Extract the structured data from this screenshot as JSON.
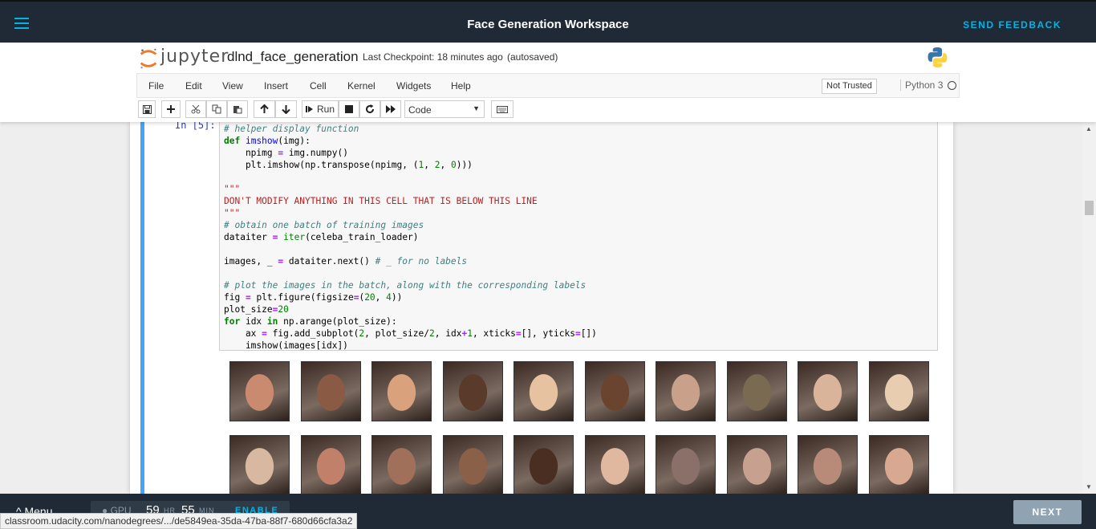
{
  "topbar": {
    "title": "Face Generation Workspace",
    "feedback_label": "SEND FEEDBACK",
    "accent": "#02b3e4"
  },
  "jupyter": {
    "logo_text": "jupyter",
    "notebook_name": "dlnd_face_generation",
    "checkpoint": "Last Checkpoint: 18 minutes ago",
    "autosaved": "(autosaved)",
    "menu": [
      "File",
      "Edit",
      "View",
      "Insert",
      "Cell",
      "Kernel",
      "Widgets",
      "Help"
    ],
    "trusted": "Not Trusted",
    "kernel": "Python 3",
    "run_label": "Run",
    "cell_type": "Code"
  },
  "cell": {
    "prompt": "In [5]:",
    "code_lines": [
      "# helper display function",
      "def imshow(img):",
      "    npimg = img.numpy()",
      "    plt.imshow(np.transpose(npimg, (1, 2, 0)))",
      "",
      "\"\"\"",
      "DON'T MODIFY ANYTHING IN THIS CELL THAT IS BELOW THIS LINE",
      "\"\"\"",
      "# obtain one batch of training images",
      "dataiter = iter(celeba_train_loader)",
      "",
      "images, _ = dataiter.next() # _ for no labels",
      "",
      "# plot the images in the batch, along with the corresponding labels",
      "fig = plt.figure(figsize=(20, 4))",
      "plot_size=20",
      "for idx in np.arange(plot_size):",
      "    ax = fig.add_subplot(2, plot_size/2, idx+1, xticks=[], yticks=[])",
      "    imshow(images[idx])"
    ]
  },
  "faces": {
    "count": 20,
    "skin_tones": [
      "#c98a70",
      "#8a5a44",
      "#d9a27c",
      "#5a3a2a",
      "#e6c2a0",
      "#6b4430",
      "#c9a08a",
      "#7a6a52",
      "#d9b49a",
      "#e8cdb0",
      "#d8b8a0",
      "#c0806a",
      "#a0705a",
      "#8a6048",
      "#4a2e22",
      "#e0b8a0",
      "#8a7068",
      "#c8a090",
      "#b88a78",
      "#d8a890"
    ]
  },
  "bottombar": {
    "menu_label": "Menu",
    "gpu_label": "GPU",
    "hours": "59",
    "hr_unit": "HR",
    "minutes": "55",
    "min_unit": "MIN",
    "enable_label": "ENABLE",
    "next_label": "NEXT"
  },
  "status_url": "classroom.udacity.com/nanodegrees/.../de5849ea-35da-47ba-88f7-680d66cfa3a2"
}
